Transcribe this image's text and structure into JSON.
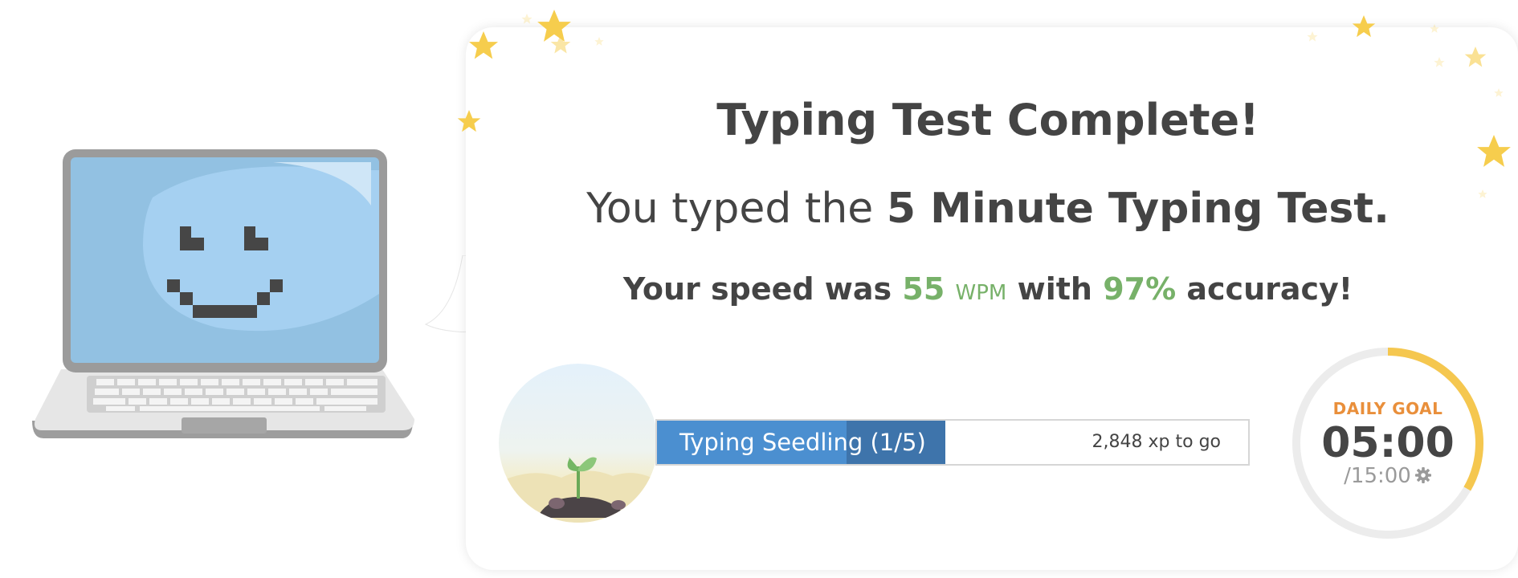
{
  "result": {
    "title": "Typing Test Complete!",
    "subtitle_prefix": "You typed the ",
    "subtitle_test_name": "5 Minute Typing Test.",
    "speed_prefix": "Your speed was ",
    "speed_value": "55",
    "speed_unit": "WPM",
    "accuracy_prefix": " with ",
    "accuracy_value": "97%",
    "accuracy_suffix": " accuracy!"
  },
  "level": {
    "label": "Typing Seedling (1/5)",
    "xp_to_go": "2,848 xp to go",
    "progress_fraction": 0.488,
    "progress_light_fraction": 0.32
  },
  "daily_goal": {
    "label": "DAILY GOAL",
    "time": "05:00",
    "total": "/15:00",
    "progress_fraction": 0.333
  },
  "icons": {
    "mascot": "laptop-smiley-icon",
    "badge": "seedling-icon",
    "settings": "gear-icon",
    "decoration": "star-icon"
  },
  "colors": {
    "accent_green": "#77b169",
    "xp_blue": "#3e74ab",
    "goal_orange": "#e98f3b",
    "goal_ring": "#f5c74f",
    "star": "#f6cd4d"
  }
}
